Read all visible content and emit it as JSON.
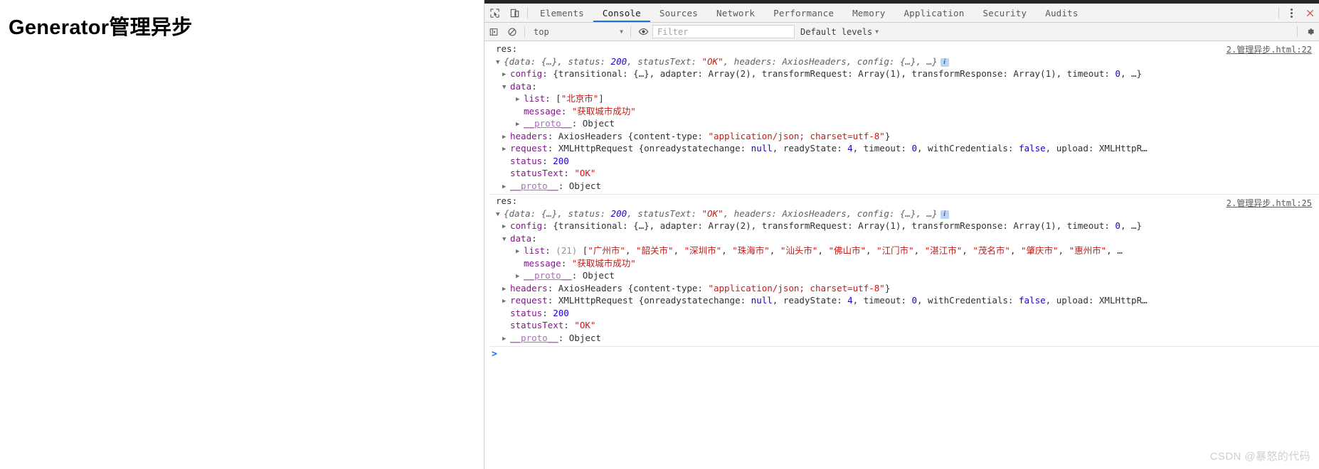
{
  "page": {
    "title": "Generator管理异步"
  },
  "watermark": "CSDN @暴怒的代码",
  "devtools": {
    "tabs": [
      {
        "label": "Elements",
        "active": false
      },
      {
        "label": "Console",
        "active": true
      },
      {
        "label": "Sources",
        "active": false
      },
      {
        "label": "Network",
        "active": false
      },
      {
        "label": "Performance",
        "active": false
      },
      {
        "label": "Memory",
        "active": false
      },
      {
        "label": "Application",
        "active": false
      },
      {
        "label": "Security",
        "active": false
      },
      {
        "label": "Audits",
        "active": false
      }
    ],
    "icons": {
      "inspect": "inspect-element-icon",
      "device": "device-toolbar-icon",
      "more": "more-options-icon",
      "close": "close-icon",
      "execute": "execute-sidebar-icon",
      "clear": "clear-console-icon",
      "eye": "live-expression-icon",
      "settings": "settings-gear-icon"
    },
    "toolbar": {
      "context": "top",
      "filter_value": "",
      "filter_placeholder": "Filter",
      "levels": "Default levels"
    },
    "prompt": ">"
  },
  "logs": [
    {
      "label": "res:",
      "source": "2.管理异步.html:22",
      "preview": {
        "open": "{",
        "data_key": "data: ",
        "data_val": "{…}",
        "sep1": ", ",
        "status_key": "status: ",
        "status_val": "200",
        "sep2": ", ",
        "statustext_key": "statusText: ",
        "statustext_val": "\"OK\"",
        "sep3": ", ",
        "headers_key": "headers: ",
        "headers_val": "AxiosHeaders",
        "sep4": ", ",
        "config_key": "config: ",
        "config_val": "{…}",
        "tail": ", …}",
        "badge": "i"
      },
      "rows": [
        {
          "key": "config",
          "value": ": {transitional: {…}, adapter: Array(2), transformRequest: Array(1), transformResponse: Array(1), timeout: 0, …}"
        },
        {
          "key": "data",
          "value": ":"
        },
        {
          "key": "list",
          "value": ": [\"北京市\"]"
        },
        {
          "key": "message",
          "value": ": \"获取城市成功\""
        },
        {
          "key": "__proto__",
          "value": ": Object"
        },
        {
          "key": "headers",
          "value": ": AxiosHeaders {content-type: \"application/json; charset=utf-8\"}"
        },
        {
          "key": "request",
          "value": ": XMLHttpRequest {onreadystatechange: null, readyState: 4, timeout: 0, withCredentials: false, upload: XMLHttpR…"
        },
        {
          "key": "status",
          "value": ": 200"
        },
        {
          "key": "statusText",
          "value": ": \"OK\""
        },
        {
          "key": "__proto__",
          "value": ": Object"
        }
      ]
    },
    {
      "label": "res:",
      "source": "2.管理异步.html:25",
      "list_count": "(21)",
      "cities": [
        "广州市",
        "韶关市",
        "深圳市",
        "珠海市",
        "汕头市",
        "佛山市",
        "江门市",
        "湛江市",
        "茂名市",
        "肇庆市",
        "惠州市"
      ],
      "rows": [
        {
          "key": "config",
          "value": ": {transitional: {…}, adapter: Array(2), transformRequest: Array(1), transformResponse: Array(1), timeout: 0, …}"
        },
        {
          "key": "data",
          "value": ":"
        },
        {
          "key": "message",
          "value": ": \"获取城市成功\""
        },
        {
          "key": "__proto__",
          "value": ": Object"
        },
        {
          "key": "headers",
          "value": ": AxiosHeaders {content-type: \"application/json; charset=utf-8\"}"
        },
        {
          "key": "request",
          "value": ": XMLHttpRequest {onreadystatechange: null, readyState: 4, timeout: 0, withCredentials: false, upload: XMLHttpR…"
        },
        {
          "key": "status",
          "value": ": 200"
        },
        {
          "key": "statusText",
          "value": ": \"OK\""
        },
        {
          "key": "__proto__",
          "value": ": Object"
        }
      ]
    }
  ]
}
